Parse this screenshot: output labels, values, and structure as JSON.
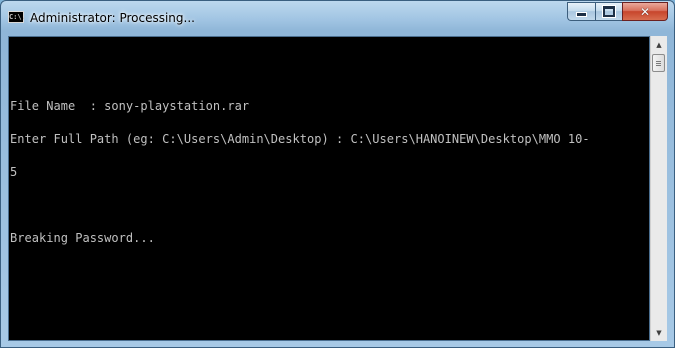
{
  "window": {
    "title": "Administrator:  Processing...",
    "icon_label": "C:\\."
  },
  "caption_buttons": {
    "minimize": "minimize-icon",
    "maximize": "maximize-icon",
    "close": "close-icon"
  },
  "console": {
    "lines": [
      "",
      "File Name  : sony-playstation.rar",
      "Enter Full Path (eg: C:\\Users\\Admin\\Desktop) : C:\\Users\\HANOINEW\\Desktop\\MMO 10-",
      "5",
      "",
      "Breaking Password..."
    ],
    "colors": {
      "background": "#000000",
      "text": "#c0c0c0"
    }
  },
  "scrollbar": {
    "up": "▲",
    "down": "▼"
  }
}
